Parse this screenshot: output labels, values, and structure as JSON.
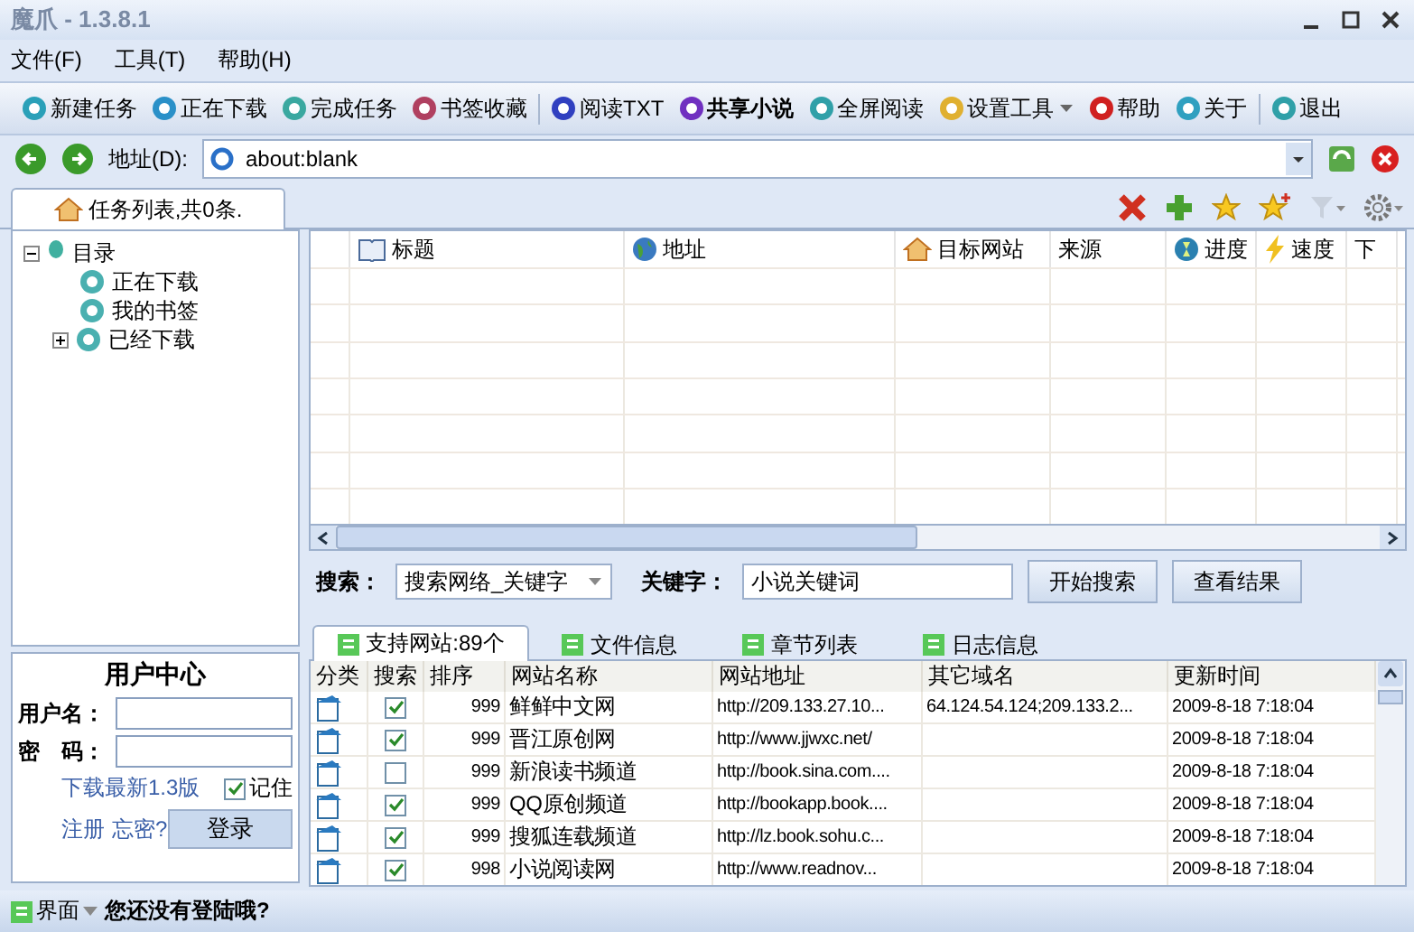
{
  "window": {
    "title": "魔爪 - 1.3.8.1"
  },
  "menu": [
    "文件(F)",
    "工具(T)",
    "帮助(H)"
  ],
  "toolbar": [
    [
      {
        "label": "新建任务",
        "bold": false,
        "dropdown": false
      },
      {
        "label": "正在下载",
        "bold": false,
        "dropdown": false
      },
      {
        "label": "完成任务",
        "bold": false,
        "dropdown": false
      },
      {
        "label": "书签收藏",
        "bold": false,
        "dropdown": false
      }
    ],
    [
      {
        "label": "阅读TXT",
        "bold": false,
        "dropdown": false
      },
      {
        "label": "共享小说",
        "bold": true,
        "dropdown": false
      },
      {
        "label": "全屏阅读",
        "bold": false,
        "dropdown": false
      },
      {
        "label": "设置工具",
        "bold": false,
        "dropdown": true
      },
      {
        "label": "帮助",
        "bold": false,
        "dropdown": false
      },
      {
        "label": "关于",
        "bold": false,
        "dropdown": false
      }
    ],
    [
      {
        "label": "退出",
        "bold": false,
        "dropdown": false
      }
    ]
  ],
  "address": {
    "label": "地址(D):",
    "value": "about:blank"
  },
  "left_tab": "任务列表,共0条.",
  "tree": {
    "label": "目录",
    "expanded": true,
    "children": [
      {
        "label": "正在下载"
      },
      {
        "label": "我的书签"
      },
      {
        "label": "已经下载",
        "expanded": false
      }
    ]
  },
  "task_table": {
    "columns": [
      "标题",
      "地址",
      "目标网站",
      "来源",
      "进度",
      "速度",
      "下"
    ]
  },
  "search": {
    "label": "搜索：",
    "mode": "搜索网络_关键字",
    "keyword_label": "关键字：",
    "keyword": "小说关键词",
    "buttons": [
      "开始搜索",
      "查看结果"
    ]
  },
  "user_center": {
    "title": "用户中心",
    "username_label": "用户名：",
    "password_label": "密　码：",
    "download_link": "下载最新1.3版",
    "remember": {
      "label": "记住",
      "checked": true
    },
    "register": "注册",
    "forgot": "忘密?",
    "login": "登录"
  },
  "bottom_tabs": [
    {
      "label": "支持网站:89个",
      "selected": true
    },
    {
      "label": "文件信息",
      "selected": false
    },
    {
      "label": "章节列表",
      "selected": false
    },
    {
      "label": "日志信息",
      "selected": false
    }
  ],
  "sites": {
    "columns": [
      "分类",
      "搜索",
      "排序",
      "网站名称",
      "网站地址",
      "其它域名",
      "更新时间"
    ],
    "rows": [
      {
        "search": true,
        "order": "999",
        "name": "鲜鲜中文网",
        "url": "http://209.133.27.10...",
        "other": "64.124.54.124;209.133.2...",
        "updated": "2009-8-18 7:18:04"
      },
      {
        "search": true,
        "order": "999",
        "name": "晋江原创网",
        "url": "http://www.jjwxc.net/",
        "other": "",
        "updated": "2009-8-18 7:18:04"
      },
      {
        "search": false,
        "order": "999",
        "name": "新浪读书频道",
        "url": "http://book.sina.com....",
        "other": "",
        "updated": "2009-8-18 7:18:04"
      },
      {
        "search": true,
        "order": "999",
        "name": "QQ原创频道",
        "url": "http://bookapp.book....",
        "other": "",
        "updated": "2009-8-18 7:18:04"
      },
      {
        "search": true,
        "order": "999",
        "name": "搜狐连载频道",
        "url": "http://lz.book.sohu.c...",
        "other": "",
        "updated": "2009-8-18 7:18:04"
      },
      {
        "search": true,
        "order": "998",
        "name": "小说阅读网",
        "url": "http://www.readnov...",
        "other": "",
        "updated": "2009-8-18 7:18:04"
      }
    ]
  },
  "status": {
    "menu": "界面",
    "message": "您还没有登陆哦?"
  }
}
